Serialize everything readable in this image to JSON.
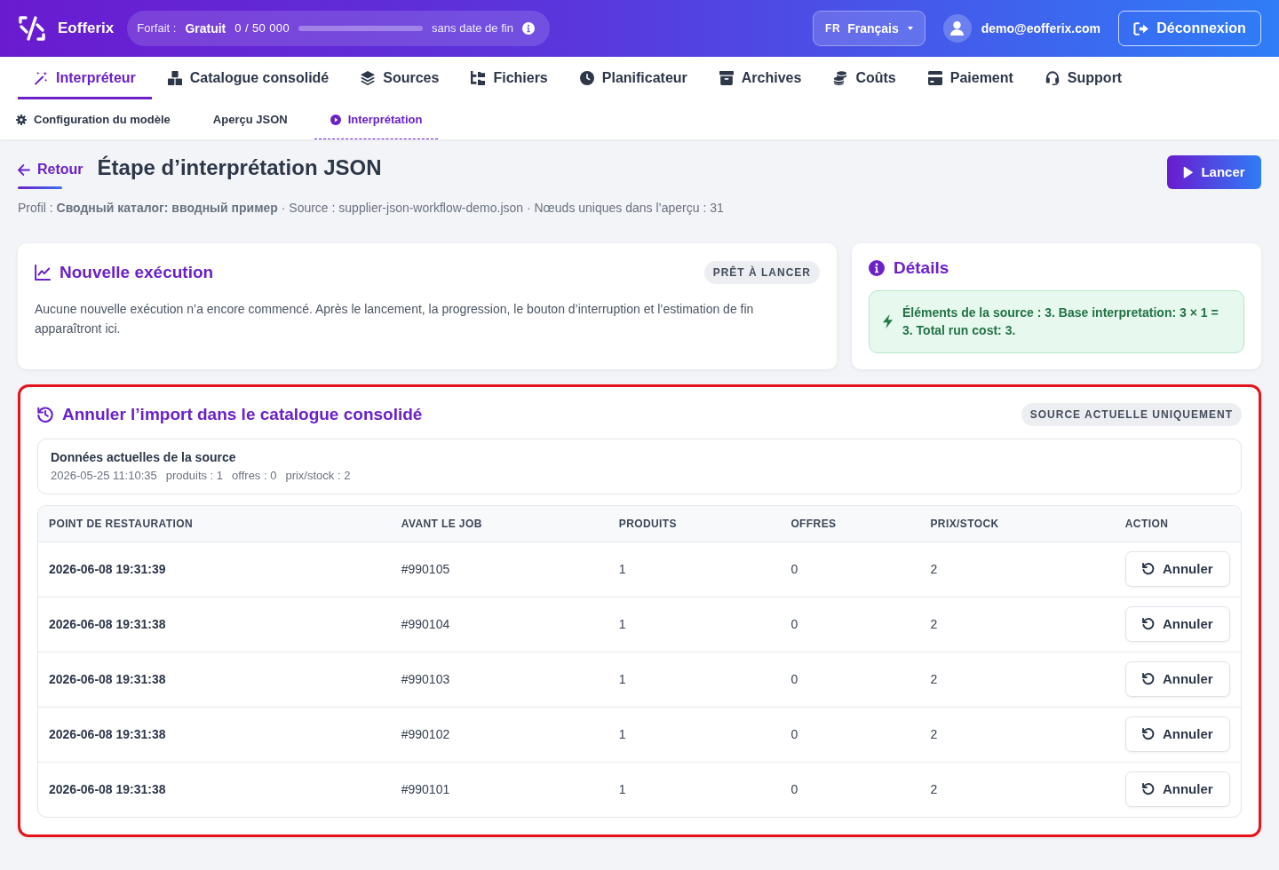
{
  "header": {
    "brand": "Eofferix",
    "plan": {
      "label": "Forfait :",
      "name": "Gratuit",
      "usage": "0 / 50 000",
      "level": 0,
      "expiry": "sans date de fin"
    },
    "language": {
      "code": "FR",
      "name": "Français"
    },
    "user_email": "demo@eofferix.com",
    "logout": "Déconnexion"
  },
  "main_tabs": [
    {
      "label": "Interpréteur",
      "selected": true
    },
    {
      "label": "Catalogue consolidé",
      "selected": false
    },
    {
      "label": "Sources",
      "selected": false
    },
    {
      "label": "Fichiers",
      "selected": false
    },
    {
      "label": "Planificateur",
      "selected": false
    },
    {
      "label": "Archives",
      "selected": false
    },
    {
      "label": "Coûts",
      "selected": false
    },
    {
      "label": "Paiement",
      "selected": false
    },
    {
      "label": "Support",
      "selected": false
    }
  ],
  "sub_tabs": [
    {
      "label": "Configuration du modèle",
      "selected": false
    },
    {
      "label": "Aperçu JSON",
      "selected": false
    },
    {
      "label": "Interprétation",
      "selected": true
    }
  ],
  "page": {
    "back": "Retour",
    "title": "Étape d’interprétation JSON",
    "run_button": "Lancer",
    "meta": "Profil : **Сводный каталог: вводный пример** · Source : supplier-json-workflow-demo.json · Nœuds uniques dans l’aperçu : 31"
  },
  "run_card": {
    "title": "Nouvelle exécution",
    "status": "PRÊT À LANCER",
    "text": "Aucune nouvelle exécution n’a encore commencé. Après le lancement, la progression, le bouton d’interruption et l’estimation de fin apparaîtront ici."
  },
  "details_card": {
    "title": "Détails",
    "cost_text": "Éléments de la source : **3.** Base interpretation: **3 × 1 = 3.** Total run cost: **3.**"
  },
  "rollback_card": {
    "highlighted": true,
    "title": "Annuler l’import dans le catalogue consolidé",
    "scope": "SOURCE ACTUELLE UNIQUEMENT",
    "current": {
      "title": "Données actuelles de la source",
      "stats": [
        "2026-05-25 11:10:35",
        "produits : 1",
        "offres : 0",
        "prix/stock : 2"
      ]
    },
    "table": {
      "columns": [
        "POINT DE RESTAURATION",
        "AVANT LE JOB",
        "PRODUITS",
        "OFFRES",
        "PRIX/STOCK",
        "ACTION"
      ],
      "rows": [
        {
          "restore_point": "2026-06-08 19:31:39",
          "before_job": "#990105",
          "products": "1",
          "offers": "0",
          "price_stock": "2",
          "action": "Annuler"
        },
        {
          "restore_point": "2026-06-08 19:31:38",
          "before_job": "#990104",
          "products": "1",
          "offers": "0",
          "price_stock": "2",
          "action": "Annuler"
        },
        {
          "restore_point": "2026-06-08 19:31:38",
          "before_job": "#990103",
          "products": "1",
          "offers": "0",
          "price_stock": "2",
          "action": "Annuler"
        },
        {
          "restore_point": "2026-06-08 19:31:38",
          "before_job": "#990102",
          "products": "1",
          "offers": "0",
          "price_stock": "2",
          "action": "Annuler"
        },
        {
          "restore_point": "2026-06-08 19:31:38",
          "before_job": "#990101",
          "products": "1",
          "offers": "0",
          "price_stock": "2",
          "action": "Annuler"
        }
      ]
    }
  }
}
